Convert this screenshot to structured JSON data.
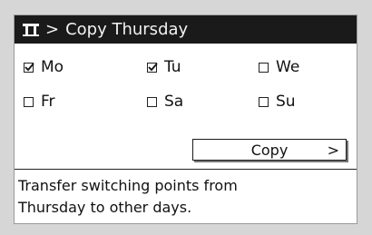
{
  "title": {
    "separator": ">",
    "text": "Copy Thursday"
  },
  "days": [
    {
      "label": "Mo",
      "checked": true
    },
    {
      "label": "Tu",
      "checked": true
    },
    {
      "label": "We",
      "checked": false
    },
    {
      "label": "Fr",
      "checked": false
    },
    {
      "label": "Sa",
      "checked": false
    },
    {
      "label": "Su",
      "checked": false
    }
  ],
  "copy_button": {
    "label": "Copy",
    "chevron": ">"
  },
  "info": {
    "line1": "Transfer switching points from",
    "line2": "Thursday to other days."
  },
  "icons": {
    "menu": "menu-icon",
    "checkbox": "checkbox-icon"
  }
}
